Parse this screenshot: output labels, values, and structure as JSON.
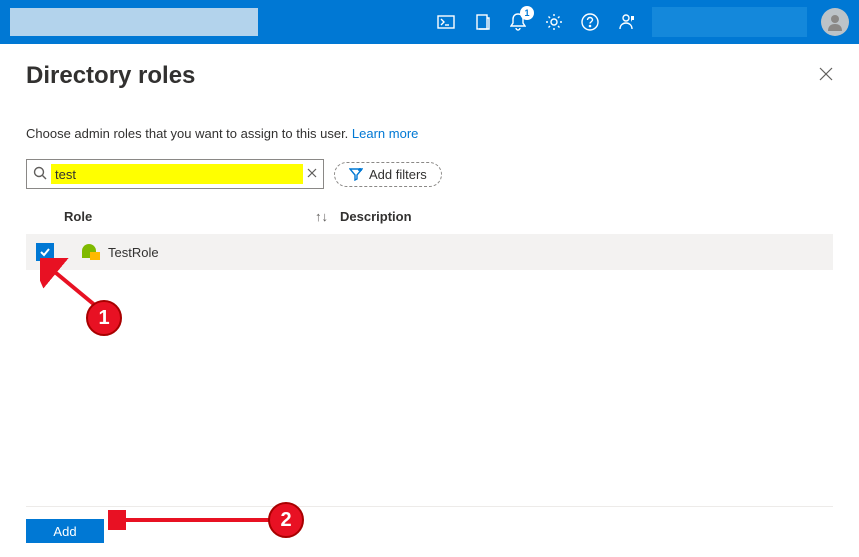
{
  "topbar": {
    "notification_count": "1"
  },
  "panel": {
    "title": "Directory roles",
    "instruction": "Choose admin roles that you want to assign to this user. ",
    "learn_more": "Learn more",
    "search_value": "test",
    "add_filters_label": "Add filters"
  },
  "table": {
    "columns": {
      "role": "Role",
      "description": "Description"
    },
    "rows": [
      {
        "name": "TestRole",
        "description": "",
        "checked": true
      }
    ]
  },
  "footer": {
    "add_label": "Add"
  },
  "annotations": {
    "one": "1",
    "two": "2"
  }
}
